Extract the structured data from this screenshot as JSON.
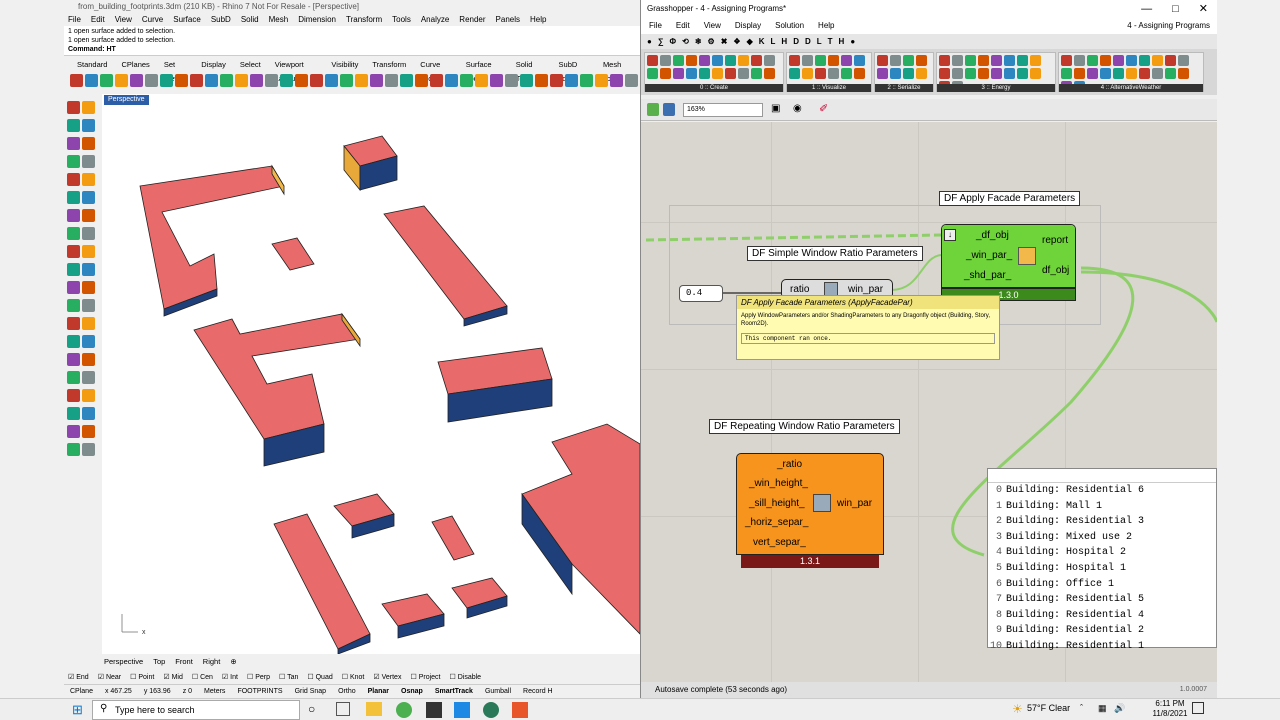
{
  "rhino": {
    "title": "from_building_footprints.3dm (210 KB) - Rhino 7 Not For Resale - [Perspective]",
    "menu": [
      "File",
      "Edit",
      "View",
      "Curve",
      "Surface",
      "SubD",
      "Solid",
      "Mesh",
      "Dimension",
      "Transform",
      "Tools",
      "Analyze",
      "Render",
      "Panels",
      "Help"
    ],
    "command_history": [
      "1 open surface added to selection.",
      "1 open surface added to selection."
    ],
    "command_prompt": "Command: HT",
    "tabs": [
      "Standard",
      "CPlanes",
      "Set View",
      "Display",
      "Select",
      "Viewport Layout",
      "Visibility",
      "Transform",
      "Curve Tools",
      "Surface Tools",
      "Solid Tools",
      "SubD Tools",
      "Mesh Tools"
    ],
    "viewport_label": "Perspective",
    "axis_x": "x",
    "view_tabs": [
      "Perspective",
      "Top",
      "Front",
      "Right",
      "⊕"
    ],
    "snaps": [
      "End",
      "Near",
      "Point",
      "Mid",
      "Cen",
      "Int",
      "Perp",
      "Tan",
      "Quad",
      "Knot",
      "Vertex",
      "Project",
      "Disable"
    ],
    "snaps_checked": [
      true,
      true,
      false,
      true,
      false,
      true,
      false,
      false,
      false,
      false,
      true,
      false,
      false
    ],
    "status": [
      "CPlane",
      "x 467.25",
      "y 163.96",
      "z 0",
      "Meters",
      "FOOTPRINTS",
      "Grid Snap",
      "Ortho",
      "Planar",
      "Osnap",
      "SmartTrack",
      "Gumball",
      "Record H"
    ]
  },
  "gh": {
    "title": "Grasshopper - 4 - Assigning Programs*",
    "doc_name": "4 - Assigning Programs",
    "menu": [
      "File",
      "Edit",
      "View",
      "Display",
      "Solution",
      "Help"
    ],
    "cat_letters": [
      "●",
      "∑",
      "Φ",
      "⟲",
      "❄",
      "⚙",
      "✖",
      "❖",
      "◆",
      "K",
      "L",
      "H",
      "D",
      "D",
      "L",
      "T",
      "H",
      "●"
    ],
    "ribbon_groups": [
      "0 :: Create",
      "1 :: Visualize",
      "2 :: Serialize",
      "3 :: Energy",
      "4 :: AlternativeWeather"
    ],
    "zoom": "163%",
    "group_fill": "#ecebe6",
    "apply": {
      "name": "DF Apply Facade Parameters",
      "inputs": [
        "_df_obj",
        "_win_par_",
        "_shd_par_"
      ],
      "outputs": [
        "report",
        "df_obj"
      ],
      "version": "1.3.0",
      "color": "#6fd43a"
    },
    "simple": {
      "name": "DF Simple Window Ratio Parameters",
      "inputs": [
        "ratio"
      ],
      "outputs": [
        "win_par"
      ]
    },
    "slider_value": "0.4",
    "tooltip": {
      "title": "DF Apply Facade Parameters (ApplyFacadePar)",
      "desc": "Apply WindowParameters and/or ShadingParameters to any Dragonfly object (Building, Story, Room2D).",
      "note": "This component ran once."
    },
    "repeating": {
      "name": "DF Repeating Window Ratio Parameters",
      "inputs": [
        "_ratio",
        "_win_height_",
        "_sill_height_",
        "_horiz_separ_",
        "vert_separ_"
      ],
      "outputs": [
        "win_par"
      ],
      "version": "1.3.1",
      "color": "#f7941d"
    },
    "panel_rows": [
      {
        "i": "0",
        "v": "Building: Residential 6"
      },
      {
        "i": "1",
        "v": "Building: Mall 1"
      },
      {
        "i": "2",
        "v": "Building: Residential 3"
      },
      {
        "i": "3",
        "v": "Building: Mixed use 2"
      },
      {
        "i": "4",
        "v": "Building: Hospital 2"
      },
      {
        "i": "5",
        "v": "Building: Hospital 1"
      },
      {
        "i": "6",
        "v": "Building: Office 1"
      },
      {
        "i": "7",
        "v": "Building: Residential 5"
      },
      {
        "i": "8",
        "v": "Building: Residential 4"
      },
      {
        "i": "9",
        "v": "Building: Residential 2"
      },
      {
        "i": "10",
        "v": "Building: Residential 1"
      }
    ],
    "status": "Autosave complete (53 seconds ago)",
    "version": "1.0.0007"
  },
  "taskbar": {
    "search": "Type here to search",
    "weather": "57°F  Clear",
    "time": "6:11 PM",
    "date": "11/8/2021"
  }
}
